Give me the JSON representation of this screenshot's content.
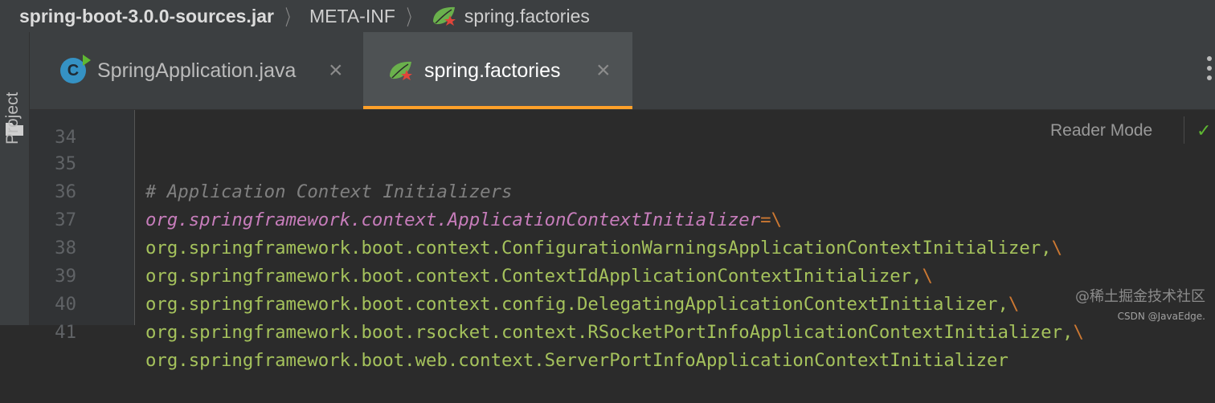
{
  "breadcrumb": {
    "root": "spring-boot-3.0.0-sources.jar",
    "folder": "META-INF",
    "file": "spring.factories"
  },
  "tool_strip": {
    "project_label": "Project"
  },
  "tabs": [
    {
      "label": "SpringApplication.java",
      "icon": "java-class-icon",
      "active": false
    },
    {
      "label": "spring.factories",
      "icon": "spring-leaf-icon",
      "active": true
    }
  ],
  "editor": {
    "reader_mode": "Reader Mode",
    "lines": [
      {
        "number": "34",
        "text": ""
      },
      {
        "number": "35",
        "text": "# Application Context Initializers"
      },
      {
        "number": "36",
        "key": "org.springframework.context.ApplicationContextInitializer",
        "op": "=",
        "esc": "\\"
      },
      {
        "number": "37",
        "val": "org.springframework.boot.context.ConfigurationWarningsApplicationContextInitializer,",
        "esc": "\\"
      },
      {
        "number": "38",
        "val": "org.springframework.boot.context.ContextIdApplicationContextInitializer,",
        "esc": "\\"
      },
      {
        "number": "39",
        "val": "org.springframework.boot.context.config.DelegatingApplicationContextInitializer,",
        "esc": "\\"
      },
      {
        "number": "40",
        "val": "org.springframework.boot.rsocket.context.RSocketPortInfoApplicationContextInitializer,",
        "esc": "\\"
      },
      {
        "number": "41",
        "val": "org.springframework.boot.web.context.ServerPortInfoApplicationContextInitializer",
        "esc": ""
      }
    ]
  },
  "watermark": {
    "line1": "@稀土掘金技术社区",
    "line2": "CSDN @JavaEdge."
  },
  "colors": {
    "accent_tab": "#ffa029",
    "comment": "#808080",
    "key": "#c77dbb",
    "value": "#a5c25c",
    "escape": "#cc7832"
  }
}
